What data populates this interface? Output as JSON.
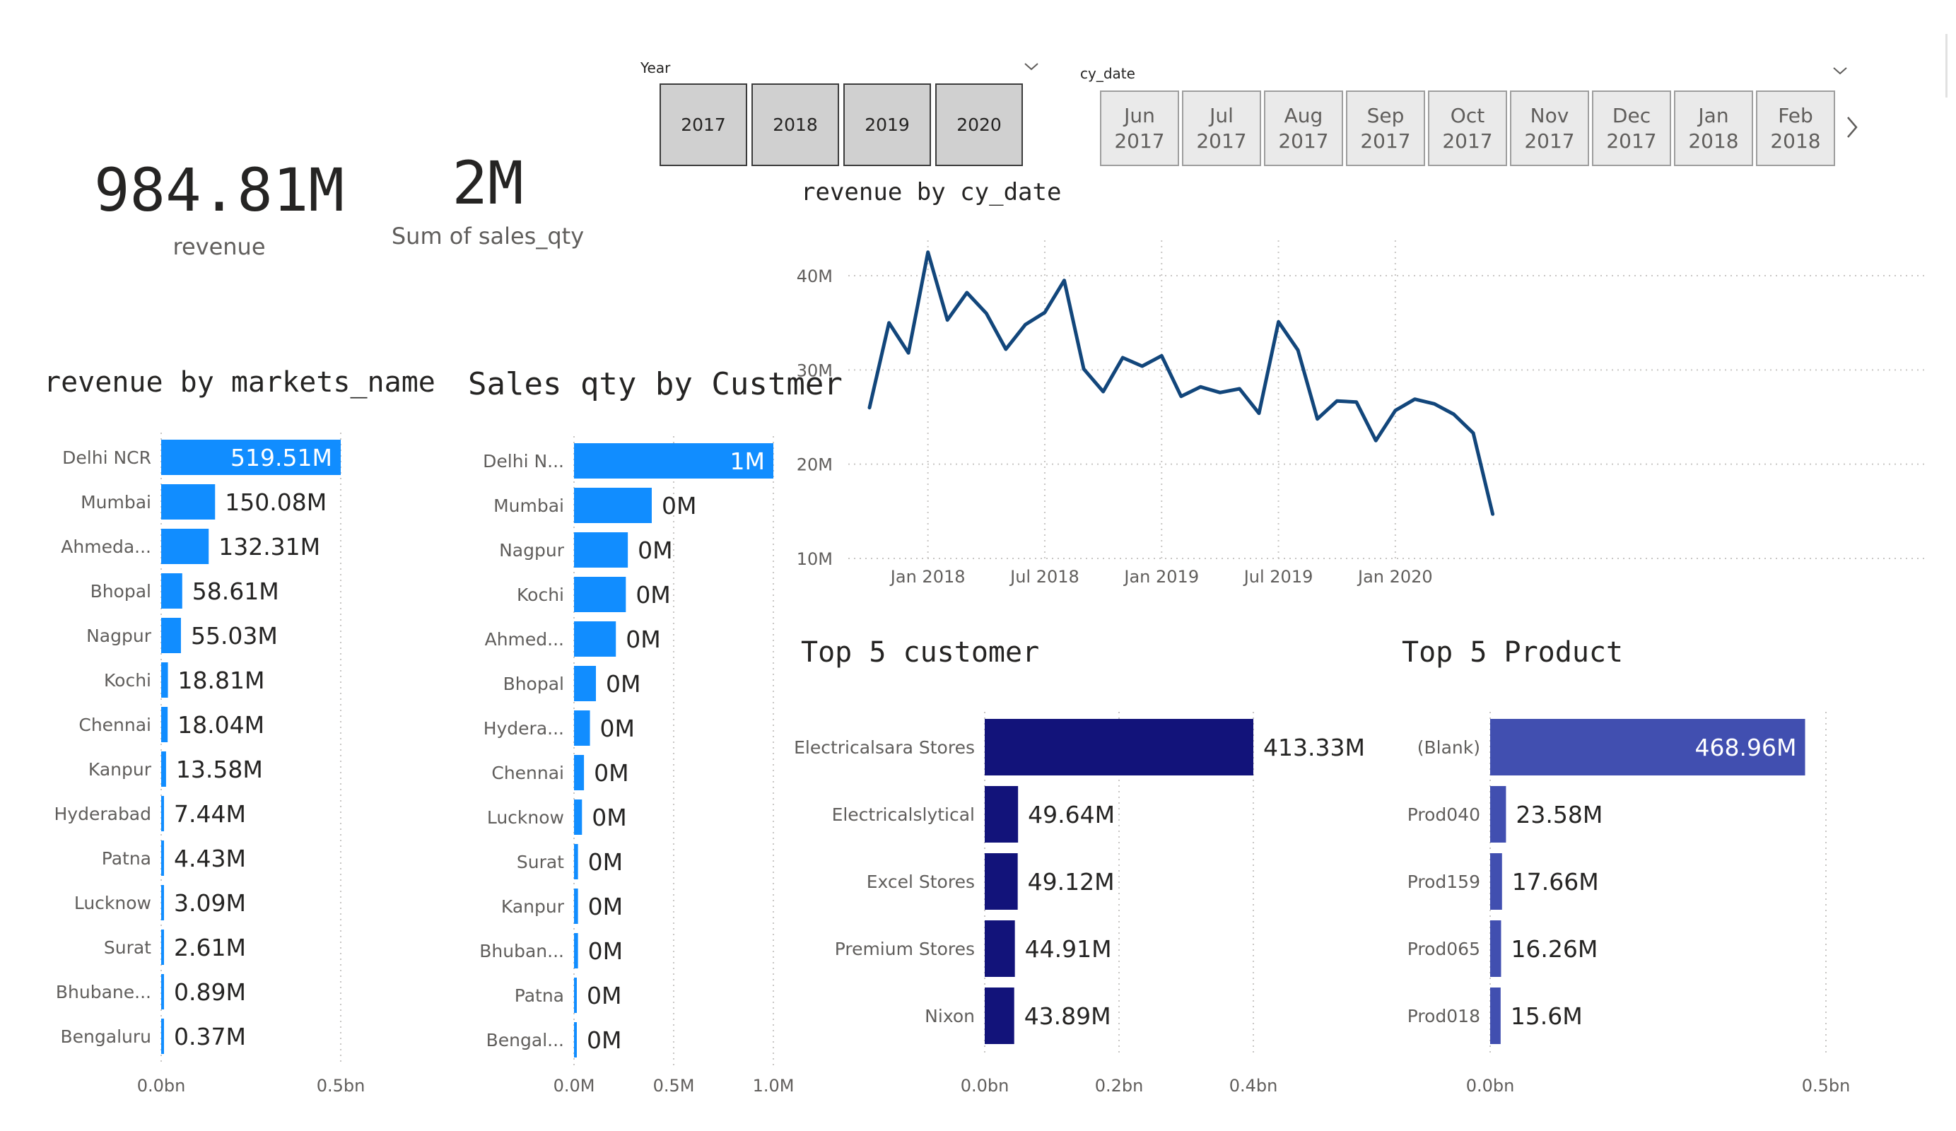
{
  "kpis": {
    "revenue": {
      "value": "984.81M",
      "label": "revenue"
    },
    "sales_qty": {
      "value": "2M",
      "label": "Sum of sales_qty"
    }
  },
  "year_slicer": {
    "title": "Year",
    "options": [
      "2017",
      "2018",
      "2019",
      "2020"
    ]
  },
  "date_slicer": {
    "title": "cy_date",
    "options": [
      {
        "month": "Jun",
        "year": "2017"
      },
      {
        "month": "Jul",
        "year": "2017"
      },
      {
        "month": "Aug",
        "year": "2017"
      },
      {
        "month": "Sep",
        "year": "2017"
      },
      {
        "month": "Oct",
        "year": "2017"
      },
      {
        "month": "Nov",
        "year": "2017"
      },
      {
        "month": "Dec",
        "year": "2017"
      },
      {
        "month": "Jan",
        "year": "2018"
      },
      {
        "month": "Feb",
        "year": "2018"
      }
    ]
  },
  "colors": {
    "market_bar": "#118dff",
    "line": "#12467b",
    "customer_bar": "#12137a",
    "product_bar": "#414fb0",
    "axis_text": "#605e5c",
    "grid": "#c8c6c4"
  },
  "chart_data": [
    {
      "id": "markets",
      "type": "bar",
      "orientation": "horizontal",
      "title": "revenue by markets_name",
      "categories": [
        "Delhi NCR",
        "Mumbai",
        "Ahmeda...",
        "Bhopal",
        "Nagpur",
        "Kochi",
        "Chennai",
        "Kanpur",
        "Hyderabad",
        "Patna",
        "Lucknow",
        "Surat",
        "Bhubane...",
        "Bengaluru"
      ],
      "values": [
        519.51,
        150.08,
        132.31,
        58.61,
        55.03,
        18.81,
        18.04,
        13.58,
        7.44,
        4.43,
        3.09,
        2.61,
        0.89,
        0.37
      ],
      "value_unit": "M",
      "labels": [
        "519.51M",
        "150.08M",
        "132.31M",
        "58.61M",
        "55.03M",
        "18.81M",
        "18.04M",
        "13.58M",
        "7.44M",
        "4.43M",
        "3.09M",
        "2.61M",
        "0.89M",
        "0.37M"
      ],
      "xlim": [
        0,
        500
      ],
      "xticks": [
        0,
        500
      ],
      "xtick_labels": [
        "0.0bn",
        "0.5bn"
      ]
    },
    {
      "id": "customers_qty",
      "type": "bar",
      "orientation": "horizontal",
      "title": "Sales qty by Custmer",
      "categories": [
        "Delhi N...",
        "Mumbai",
        "Nagpur",
        "Kochi",
        "Ahmed...",
        "Bhopal",
        "Hydera...",
        "Chennai",
        "Lucknow",
        "Surat",
        "Kanpur",
        "Bhuban...",
        "Patna",
        "Bengal..."
      ],
      "values": [
        1.0,
        0.39,
        0.27,
        0.26,
        0.21,
        0.11,
        0.08,
        0.05,
        0.04,
        0.02,
        0.02,
        0.02,
        0.01,
        0.01
      ],
      "value_unit": "M",
      "labels": [
        "1M",
        "0M",
        "0M",
        "0M",
        "0M",
        "0M",
        "0M",
        "0M",
        "0M",
        "0M",
        "0M",
        "0M",
        "0M",
        "0M"
      ],
      "xlim": [
        0,
        1.0
      ],
      "xticks": [
        0,
        0.5,
        1.0
      ],
      "xtick_labels": [
        "0.0M",
        "0.5M",
        "1.0M"
      ]
    },
    {
      "id": "revenue_line",
      "type": "line",
      "title": "revenue by cy_date",
      "x": [
        "2017-10",
        "2017-11",
        "2017-12",
        "2018-01",
        "2018-02",
        "2018-03",
        "2018-04",
        "2018-05",
        "2018-06",
        "2018-07",
        "2018-08",
        "2018-09",
        "2018-10",
        "2018-11",
        "2018-12",
        "2019-01",
        "2019-02",
        "2019-03",
        "2019-04",
        "2019-05",
        "2019-06",
        "2019-07",
        "2019-08",
        "2019-09",
        "2019-10",
        "2019-11",
        "2019-12",
        "2020-01",
        "2020-02",
        "2020-03",
        "2020-04",
        "2020-05",
        "2020-06"
      ],
      "values": [
        26.0,
        35.0,
        31.8,
        42.5,
        35.3,
        38.2,
        36.0,
        32.2,
        34.8,
        36.1,
        39.5,
        30.1,
        27.7,
        31.3,
        30.4,
        31.5,
        27.2,
        28.2,
        27.6,
        28.0,
        25.4,
        35.1,
        32.1,
        24.8,
        26.7,
        26.6,
        22.5,
        25.7,
        26.9,
        26.4,
        25.3,
        23.3,
        14.7
      ],
      "value_unit": "M",
      "ylim": [
        10,
        40
      ],
      "yticks": [
        10,
        20,
        30,
        40
      ],
      "ytick_labels": [
        "10M",
        "20M",
        "30M",
        "40M"
      ],
      "xtick_positions": [
        "2018-01",
        "2018-07",
        "2019-01",
        "2019-07",
        "2020-01"
      ],
      "xtick_labels": [
        "Jan 2018",
        "Jul 2018",
        "Jan 2019",
        "Jul 2019",
        "Jan 2020"
      ]
    },
    {
      "id": "top_customers",
      "type": "bar",
      "orientation": "horizontal",
      "title": "Top 5 customer",
      "categories": [
        "Electricalsara Stores",
        "Electricalslytical",
        "Excel Stores",
        "Premium Stores",
        "Nixon"
      ],
      "values": [
        413.33,
        49.64,
        49.12,
        44.91,
        43.89
      ],
      "value_unit": "M",
      "labels": [
        "413.33M",
        "49.64M",
        "49.12M",
        "44.91M",
        "43.89M"
      ],
      "xlim": [
        0,
        400
      ],
      "xticks": [
        0,
        200,
        400
      ],
      "xtick_labels": [
        "0.0bn",
        "0.2bn",
        "0.4bn"
      ]
    },
    {
      "id": "top_products",
      "type": "bar",
      "orientation": "horizontal",
      "title": "Top 5 Product",
      "categories": [
        "(Blank)",
        "Prod040",
        "Prod159",
        "Prod065",
        "Prod018"
      ],
      "values": [
        468.96,
        23.58,
        17.66,
        16.26,
        15.6
      ],
      "value_unit": "M",
      "labels": [
        "468.96M",
        "23.58M",
        "17.66M",
        "16.26M",
        "15.6M"
      ],
      "xlim": [
        0,
        500
      ],
      "xticks": [
        0,
        500
      ],
      "xtick_labels": [
        "0.0bn",
        "0.5bn"
      ]
    }
  ]
}
